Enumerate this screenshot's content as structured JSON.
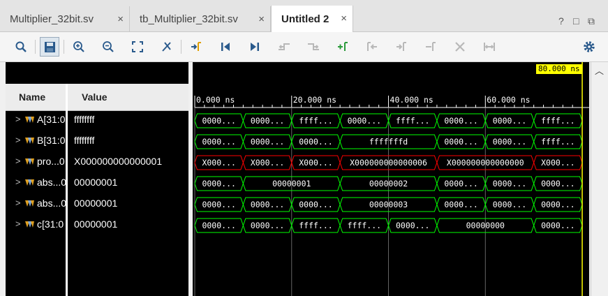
{
  "tabs": [
    {
      "label": "Multiplier_32bit.sv",
      "close": "×"
    },
    {
      "label": "tb_Multiplier_32bit.sv",
      "close": "×"
    },
    {
      "label": "Untitled 2",
      "close": "×"
    }
  ],
  "window_controls": [
    "?",
    "□",
    "⧉"
  ],
  "toolbar": {
    "icons": [
      "search-icon",
      "save-icon",
      "zoom-in-icon",
      "zoom-out-icon",
      "zoom-fit-icon",
      "cursor-snap-icon",
      "go-to-cursor-icon",
      "go-to-start-icon",
      "go-to-end-icon",
      "previous-transition-icon",
      "next-transition-icon",
      "add-marker-icon",
      "previous-marker-icon",
      "next-marker-icon",
      "swap-cursors-icon",
      "delete-marker-icon",
      "marker-span-icon",
      "settings-icon"
    ]
  },
  "columns": {
    "name": "Name",
    "value": "Value"
  },
  "cursor": {
    "label": "80.000 ns",
    "position_ns": 80
  },
  "timescale": {
    "labels": [
      "0.000 ns",
      "20.000 ns",
      "40.000 ns",
      "60.000 ns"
    ],
    "major_ns": [
      0,
      20,
      40,
      60
    ],
    "view_start_ns": 0,
    "view_end_ns": 81
  },
  "signals": [
    {
      "name": "A[31:0",
      "value": "ffffffff",
      "color": "#00ff00",
      "segments": [
        {
          "start": 0,
          "end": 10,
          "label": "0000..."
        },
        {
          "start": 10,
          "end": 20,
          "label": "0000..."
        },
        {
          "start": 20,
          "end": 30,
          "label": "ffff..."
        },
        {
          "start": 30,
          "end": 40,
          "label": "0000..."
        },
        {
          "start": 40,
          "end": 50,
          "label": "ffff..."
        },
        {
          "start": 50,
          "end": 60,
          "label": "0000..."
        },
        {
          "start": 60,
          "end": 70,
          "label": "0000..."
        },
        {
          "start": 70,
          "end": 80,
          "label": "ffff..."
        }
      ]
    },
    {
      "name": "B[31:0",
      "value": "ffffffff",
      "color": "#00ff00",
      "segments": [
        {
          "start": 0,
          "end": 10,
          "label": "0000..."
        },
        {
          "start": 10,
          "end": 20,
          "label": "0000..."
        },
        {
          "start": 20,
          "end": 30,
          "label": "0000..."
        },
        {
          "start": 30,
          "end": 50,
          "label": "fffffffd"
        },
        {
          "start": 50,
          "end": 60,
          "label": "0000..."
        },
        {
          "start": 60,
          "end": 70,
          "label": "0000..."
        },
        {
          "start": 70,
          "end": 80,
          "label": "ffff..."
        }
      ]
    },
    {
      "name": "pro...0",
      "value": "X000000000000001",
      "color": "#ff0000",
      "segments": [
        {
          "start": 0,
          "end": 10,
          "label": "X000..."
        },
        {
          "start": 10,
          "end": 20,
          "label": "X000..."
        },
        {
          "start": 20,
          "end": 30,
          "label": "X000..."
        },
        {
          "start": 30,
          "end": 50,
          "label": "X000000000000006"
        },
        {
          "start": 50,
          "end": 70,
          "label": "X000000000000000"
        },
        {
          "start": 70,
          "end": 80,
          "label": "X000..."
        }
      ]
    },
    {
      "name": "abs...0",
      "value": "00000001",
      "color": "#00ff00",
      "segments": [
        {
          "start": 0,
          "end": 10,
          "label": "0000..."
        },
        {
          "start": 10,
          "end": 30,
          "label": "00000001"
        },
        {
          "start": 30,
          "end": 50,
          "label": "00000002"
        },
        {
          "start": 50,
          "end": 60,
          "label": "0000..."
        },
        {
          "start": 60,
          "end": 70,
          "label": "0000..."
        },
        {
          "start": 70,
          "end": 80,
          "label": "0000..."
        }
      ]
    },
    {
      "name": "abs...0",
      "value": "00000001",
      "color": "#00ff00",
      "segments": [
        {
          "start": 0,
          "end": 10,
          "label": "0000..."
        },
        {
          "start": 10,
          "end": 20,
          "label": "0000..."
        },
        {
          "start": 20,
          "end": 30,
          "label": "0000..."
        },
        {
          "start": 30,
          "end": 50,
          "label": "00000003"
        },
        {
          "start": 50,
          "end": 60,
          "label": "0000..."
        },
        {
          "start": 60,
          "end": 70,
          "label": "0000..."
        },
        {
          "start": 70,
          "end": 80,
          "label": "0000..."
        }
      ]
    },
    {
      "name": "c[31:0",
      "value": "00000001",
      "color": "#00ff00",
      "segments": [
        {
          "start": 0,
          "end": 10,
          "label": "0000..."
        },
        {
          "start": 10,
          "end": 20,
          "label": "0000..."
        },
        {
          "start": 20,
          "end": 30,
          "label": "ffff..."
        },
        {
          "start": 30,
          "end": 40,
          "label": "ffff..."
        },
        {
          "start": 40,
          "end": 50,
          "label": "0000..."
        },
        {
          "start": 50,
          "end": 70,
          "label": "00000000"
        },
        {
          "start": 70,
          "end": 80,
          "label": "0000..."
        }
      ]
    }
  ]
}
